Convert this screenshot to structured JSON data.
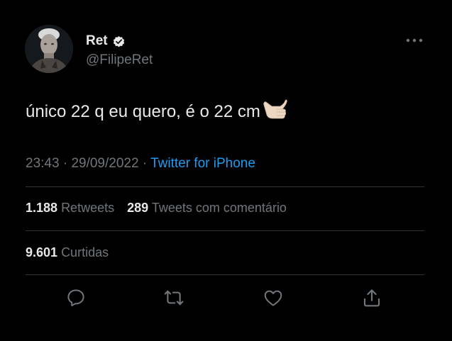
{
  "tweet": {
    "display_name": "Ret",
    "handle": "@FilipeRet",
    "text": "único 22 q eu quero, é o 22 cm",
    "time": "23:43",
    "date": "29/09/2022",
    "separator": "·",
    "source": "Twitter for iPhone",
    "emoji": "call-me-hand-emoji"
  },
  "stats": {
    "retweets_count": "1.188",
    "retweets_label": "Retweets",
    "quotes_count": "289",
    "quotes_label": "Tweets com comentário",
    "likes_count": "9.601",
    "likes_label": "Curtidas"
  },
  "icons": {
    "verified": "verified-badge-icon",
    "more": "more-options-icon",
    "reply": "reply-icon",
    "retweet": "retweet-icon",
    "like": "like-icon",
    "share": "share-icon"
  },
  "colors": {
    "background": "#000000",
    "text_primary": "#e7e9ea",
    "text_secondary": "#71767b",
    "link": "#1d9bf0",
    "divider": "#2f3336"
  }
}
